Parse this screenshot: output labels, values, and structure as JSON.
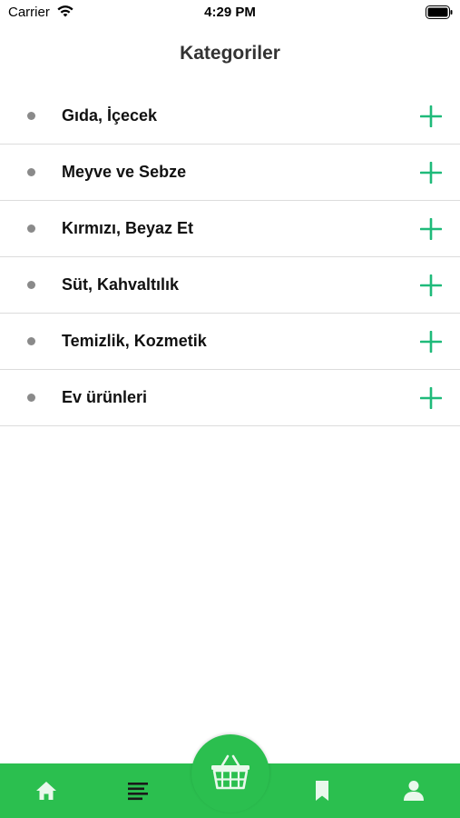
{
  "status_bar": {
    "carrier": "Carrier",
    "time": "4:29 PM"
  },
  "page_title": "Kategoriler",
  "categories": [
    {
      "label": "Gıda, İçecek"
    },
    {
      "label": "Meyve ve Sebze"
    },
    {
      "label": "Kırmızı, Beyaz Et"
    },
    {
      "label": "Süt, Kahvaltılık"
    },
    {
      "label": "Temizlik, Kozmetik"
    },
    {
      "label": "Ev ürünleri"
    }
  ],
  "tab_bar": {
    "tabs": [
      {
        "icon": "home-icon"
      },
      {
        "icon": "list-icon",
        "selected": true
      },
      {
        "icon": "basket-icon"
      },
      {
        "icon": "bookmark-icon"
      },
      {
        "icon": "profile-icon"
      }
    ]
  },
  "colors": {
    "accent": "#2bbf4f",
    "plus": "#1fba7a",
    "bullet": "#8a8a8a",
    "divider": "#dcdcdc"
  }
}
